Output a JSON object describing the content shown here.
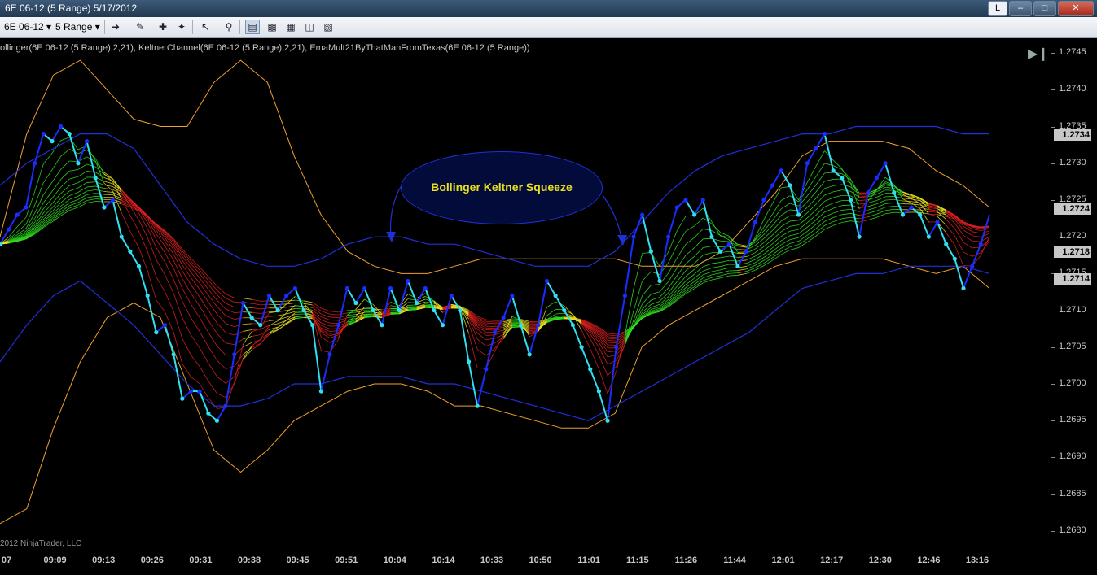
{
  "window": {
    "title": "6E 06-12 (5 Range)  5/17/2012",
    "controls": [
      "L",
      "–",
      "□",
      "✕"
    ]
  },
  "toolbar": {
    "instrument": "6E 06-12",
    "period": "5 Range",
    "icons": [
      "line-tool-icon",
      "pencil-icon",
      "zoom-icon",
      "cursor-icon",
      "magnifier-icon",
      "chart-style-icon",
      "indicators-icon",
      "strategies-icon",
      "data-box-icon",
      "properties-icon"
    ]
  },
  "indicator_label": "ollinger(6E 06-12 (5 Range),2,21), KeltnerChannel(6E 06-12 (5 Range),2,21), EmaMult21ByThatManFromTexas(6E 06-12 (5 Range))",
  "copyright": "2012 NinjaTrader, LLC",
  "annotation": "Bollinger Keltner Squeeze",
  "price_boxes": [
    "1.2734",
    "1.2724",
    "1.2718",
    "1.2714"
  ],
  "colors": {
    "bollinger": "#f0a030",
    "keltner": "#2030d8",
    "price_line": "#30e0f0",
    "up": "#30e020",
    "down": "#e02020",
    "neutral": "#e8e020"
  },
  "chart_data": {
    "type": "line",
    "ylim": [
      1.2677,
      1.2747
    ],
    "yticks": [
      "1.2680",
      "1.2685",
      "1.2690",
      "1.2695",
      "1.2700",
      "1.2705",
      "1.2710",
      "1.2715",
      "1.2720",
      "1.2725",
      "1.2730",
      "1.2735",
      "1.2740",
      "1.2745"
    ],
    "xticks": [
      "07",
      "09:09",
      "09:13",
      "09:26",
      "09:31",
      "09:38",
      "09:45",
      "09:51",
      "10:04",
      "10:14",
      "10:33",
      "10:50",
      "11:01",
      "11:15",
      "11:26",
      "11:44",
      "12:01",
      "12:17",
      "12:30",
      "12:46",
      "13:16"
    ],
    "price": [
      1.2719,
      1.2721,
      1.2723,
      1.2724,
      1.273,
      1.2734,
      1.2733,
      1.2735,
      1.2734,
      1.273,
      1.2733,
      1.2728,
      1.2724,
      1.2725,
      1.272,
      1.2718,
      1.2716,
      1.2712,
      1.2707,
      1.2708,
      1.2704,
      1.2698,
      1.2699,
      1.2699,
      1.2696,
      1.2695,
      1.2697,
      1.2704,
      1.2711,
      1.2709,
      1.2708,
      1.2712,
      1.271,
      1.2712,
      1.2713,
      1.271,
      1.2708,
      1.2699,
      1.2704,
      1.2708,
      1.2713,
      1.2711,
      1.2713,
      1.271,
      1.2708,
      1.2713,
      1.271,
      1.2714,
      1.2711,
      1.2713,
      1.271,
      1.2708,
      1.2712,
      1.271,
      1.2703,
      1.2697,
      1.2702,
      1.2707,
      1.2709,
      1.2712,
      1.2708,
      1.2704,
      1.2708,
      1.2714,
      1.2712,
      1.271,
      1.2708,
      1.2705,
      1.2702,
      1.2699,
      1.2695,
      1.2705,
      1.2712,
      1.272,
      1.2723,
      1.2718,
      1.2714,
      1.272,
      1.2724,
      1.2725,
      1.2723,
      1.2725,
      1.272,
      1.2718,
      1.2719,
      1.2716,
      1.2718,
      1.2722,
      1.2725,
      1.2727,
      1.2729,
      1.2727,
      1.2723,
      1.273,
      1.2732,
      1.2734,
      1.2729,
      1.2728,
      1.2725,
      1.272,
      1.2726,
      1.2728,
      1.273,
      1.2726,
      1.2723,
      1.2724,
      1.2723,
      1.272,
      1.2722,
      1.2719,
      1.2717,
      1.2713,
      1.2716,
      1.2719,
      1.2723
    ],
    "bollinger_upper": [
      1.272,
      1.2734,
      1.2742,
      1.2744,
      1.274,
      1.2736,
      1.2735,
      1.2735,
      1.2741,
      1.2744,
      1.2741,
      1.2731,
      1.2723,
      1.2718,
      1.2716,
      1.2715,
      1.2715,
      1.2716,
      1.2717,
      1.2717,
      1.2717,
      1.2717,
      1.2717,
      1.2717,
      1.2716,
      1.2716,
      1.2716,
      1.2718,
      1.2722,
      1.2726,
      1.2731,
      1.2733,
      1.2733,
      1.2733,
      1.2732,
      1.2729,
      1.2727,
      1.2724
    ],
    "bollinger_lower": [
      1.2681,
      1.2683,
      1.2694,
      1.2703,
      1.2709,
      1.2711,
      1.2709,
      1.27,
      1.2691,
      1.2688,
      1.2691,
      1.2695,
      1.2697,
      1.2699,
      1.27,
      1.27,
      1.2699,
      1.2697,
      1.2697,
      1.2696,
      1.2695,
      1.2694,
      1.2694,
      1.2696,
      1.2705,
      1.2708,
      1.271,
      1.2712,
      1.2714,
      1.2716,
      1.2717,
      1.2717,
      1.2717,
      1.2717,
      1.2716,
      1.2715,
      1.2716,
      1.2713
    ],
    "keltner_upper": [
      1.2727,
      1.273,
      1.2732,
      1.2734,
      1.2734,
      1.2732,
      1.2727,
      1.2722,
      1.2719,
      1.2717,
      1.2716,
      1.2716,
      1.2717,
      1.2719,
      1.272,
      1.272,
      1.2719,
      1.2719,
      1.2718,
      1.2717,
      1.2716,
      1.2716,
      1.2716,
      1.2718,
      1.2722,
      1.2726,
      1.2729,
      1.2731,
      1.2732,
      1.2733,
      1.2734,
      1.2734,
      1.2735,
      1.2735,
      1.2735,
      1.2735,
      1.2734,
      1.2734
    ],
    "keltner_lower": [
      1.2703,
      1.2708,
      1.2712,
      1.2714,
      1.2711,
      1.2708,
      1.2704,
      1.27,
      1.2697,
      1.2697,
      1.2698,
      1.27,
      1.27,
      1.2701,
      1.2701,
      1.2701,
      1.27,
      1.27,
      1.2699,
      1.2698,
      1.2697,
      1.2696,
      1.2695,
      1.2697,
      1.2699,
      1.2701,
      1.2703,
      1.2705,
      1.2707,
      1.271,
      1.2713,
      1.2714,
      1.2715,
      1.2715,
      1.2716,
      1.2716,
      1.2716,
      1.2715
    ]
  }
}
